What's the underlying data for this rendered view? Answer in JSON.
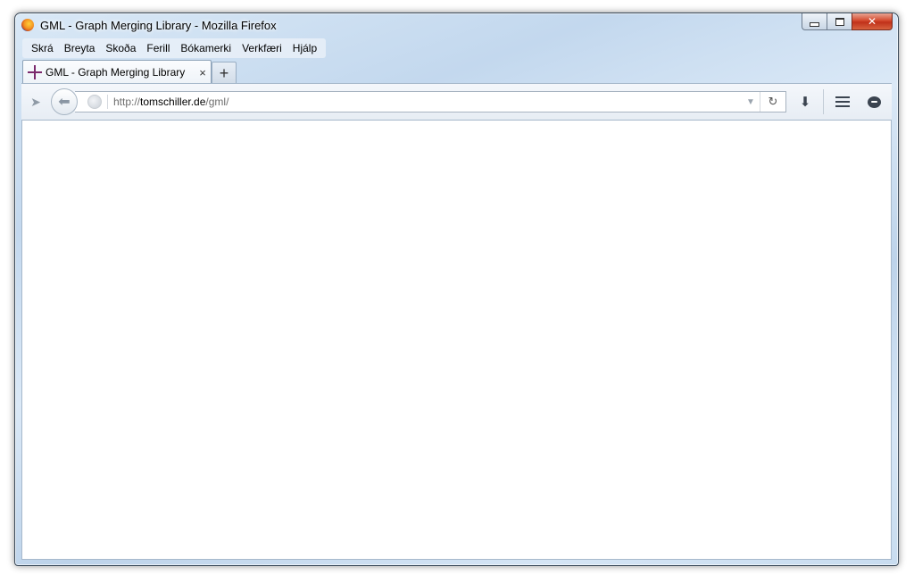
{
  "window": {
    "title": "GML - Graph Merging Library - Mozilla Firefox",
    "app_icon": "firefox-icon",
    "controls": [
      "minimize-icon",
      "maximize-icon",
      "close-icon"
    ]
  },
  "menubar": {
    "items": [
      "Skrá",
      "Breyta",
      "Skoða",
      "Ferill",
      "Bókamerki",
      "Verkfæri",
      "Hjálp"
    ]
  },
  "tabs": [
    {
      "title": "GML - Graph Merging Library",
      "favicon": "gml-favicon-icon",
      "close_glyph": "×"
    }
  ],
  "newtab": {
    "glyph": "+"
  },
  "navbar": {
    "url_scheme": "http://",
    "url_host": "tomschiller.de",
    "url_path": "/gml/",
    "icons": [
      "send-tab-icon",
      "back-arrow-icon",
      "site-identity-icon",
      "url-dropdown-icon",
      "reload-icon",
      "download-icon",
      "menu-icon",
      "chat-icon"
    ],
    "glyphs": {
      "send": "➤",
      "back": "⬅",
      "dropdown": "▼",
      "reload": "↻",
      "download": "⬇"
    }
  },
  "colors": {
    "frame": "#c8dcef",
    "close_button": "#c0311a",
    "favicon": "#7b2a6d"
  }
}
